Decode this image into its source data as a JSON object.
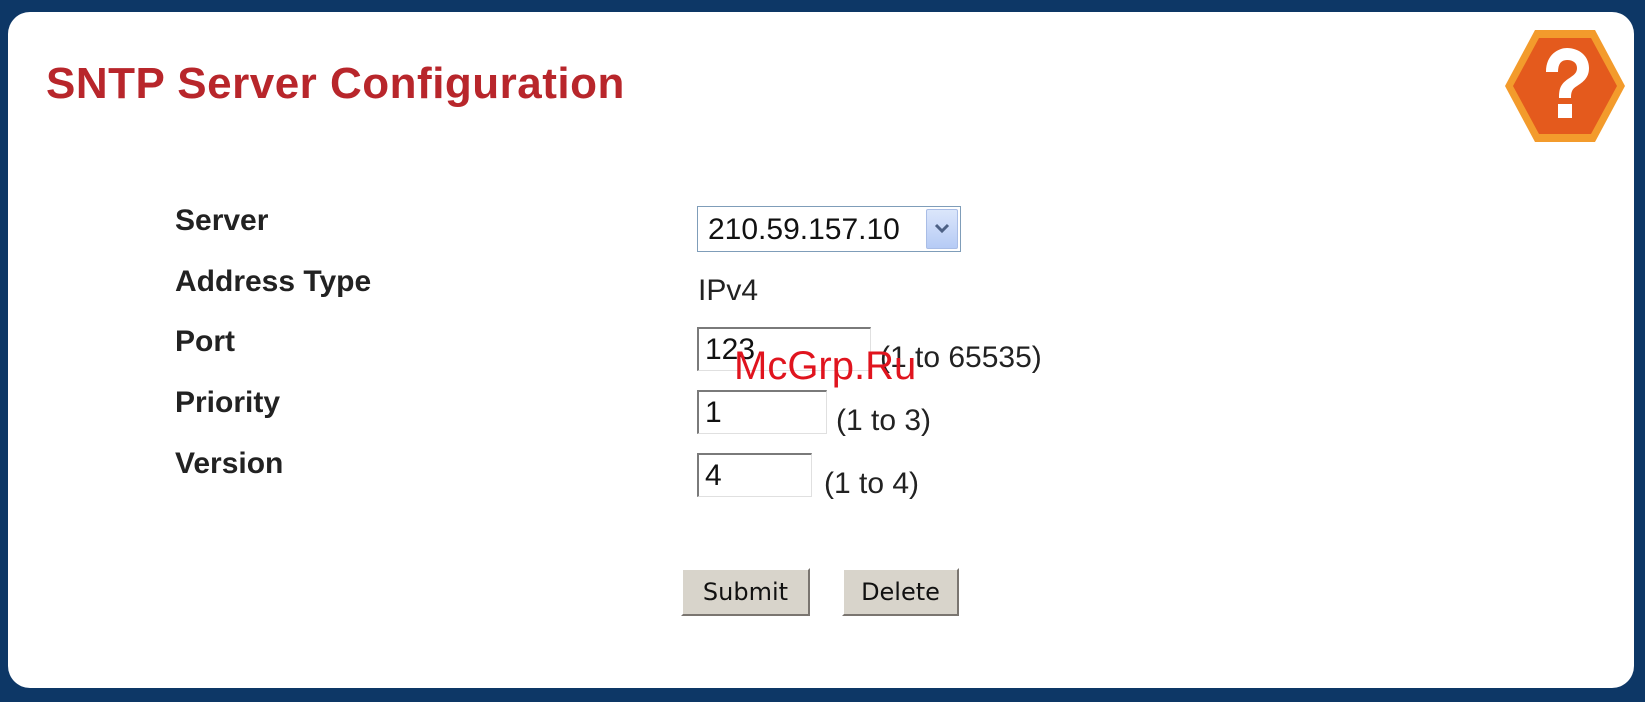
{
  "page": {
    "title": "SNTP Server Configuration",
    "help_icon": "question-mark-hexagon-icon",
    "accent_color": "#b8262b",
    "background_color": "#0d3766"
  },
  "form": {
    "server": {
      "label": "Server",
      "selected_value": "210.59.157.10"
    },
    "address_type": {
      "label": "Address Type",
      "value": "IPv4"
    },
    "port": {
      "label": "Port",
      "value": "123",
      "range": "(1 to 65535)"
    },
    "priority": {
      "label": "Priority",
      "value": "1",
      "range": "(1 to 3)"
    },
    "version": {
      "label": "Version",
      "value": "4",
      "range": "(1 to 4)"
    }
  },
  "actions": {
    "submit_label": "Submit",
    "delete_label": "Delete"
  },
  "watermark": "McGrp.Ru"
}
